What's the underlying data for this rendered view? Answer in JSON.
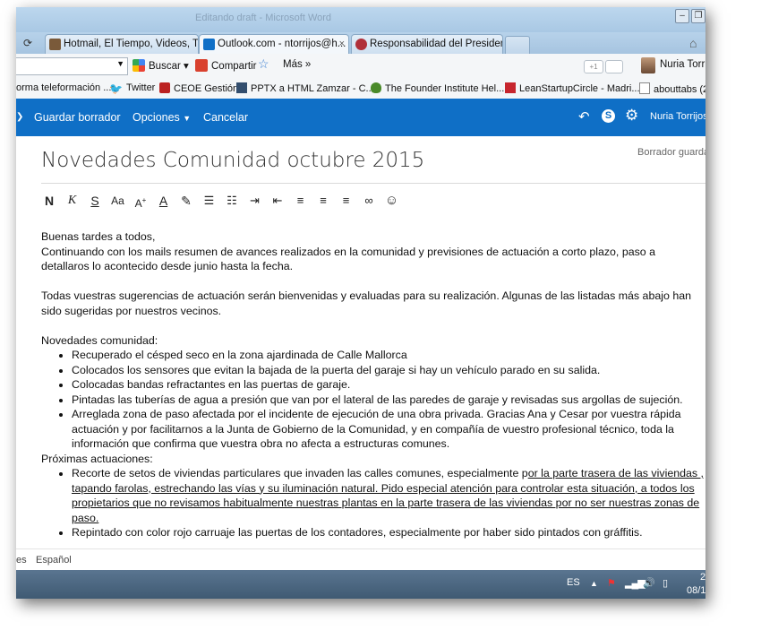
{
  "window": {
    "title": "Editando draft - Microsoft Word"
  },
  "tabs": [
    {
      "label": "Hotmail, El Tiempo, Videos, TV...",
      "icon_color": "#7a5a3a"
    },
    {
      "label": "Outlook.com - ntorrijos@h...",
      "icon_color": "#0f6fc6",
      "close": "×"
    },
    {
      "label": "Responsabilidad del Presidente...",
      "icon_color": "#b0303a"
    }
  ],
  "toolbar": {
    "buscar": "Buscar",
    "compartir": "Compartir",
    "mas": "Más »",
    "plusone": "+1",
    "user": "Nuria Torrij"
  },
  "bookmarks": [
    "orma teleformación ...",
    "Twitter",
    "CEOE Gestión",
    "PPTX a HTML  Zamzar - C...",
    "The Founder Institute Hel...",
    "LeanStartupCircle - Madri...",
    "abouttabs (2"
  ],
  "outlook": {
    "save_draft": "Guardar borrador",
    "options": "Opciones",
    "cancel": "Cancelar",
    "user_name": "Nuria Torrijos",
    "draft_status": "Borrador guarda",
    "accent": "#0f6fc6"
  },
  "message": {
    "subject": "Novedades Comunidad octubre 2015",
    "greeting": "Buenas tardes a todos,",
    "intro": "Continuando con los mails resumen de avances realizados en la comunidad y previsiones de actuación a corto plazo, paso a detallaros lo acontecido desde junio hasta la fecha.",
    "suggestions": "Todas vuestras sugerencias de actuación serán bienvenidas y evaluadas para su realización. Algunas de las listadas más abajo han sido sugeridas por nuestros vecinos.",
    "news_heading": "Novedades comunidad:",
    "news_items": [
      "Recuperado el césped seco en la zona ajardinada de Calle Mallorca",
      "Colocados los sensores que evitan la bajada de la puerta del garaje si hay un vehículo parado en su salida.",
      "Colocadas bandas refractantes en las puertas de garaje.",
      "Pintadas las tuberías de agua a presión que van por el lateral de las paredes de garaje y revisadas sus argollas de sujeción.",
      "Arreglada zona de paso afectada por el incidente de ejecución de una obra privada. Gracias Ana y Cesar por vuestra rápida actuación y por facilitarnos a la Junta de Gobierno de la Comunidad, y en compañía de vuestro profesional técnico, toda la información que confirma que vuestra obra no afecta a estructuras comunes."
    ],
    "next_heading": "Próximas actuaciones:",
    "next_item1_plain": "Recorte de setos de viviendas particulares que invaden las calles comunes, especialmente p",
    "next_item1_underlined": "or la parte trasera de las viviendas , tapando farolas, estrechando las vías y su iluminación natural. Pido especial atención para controlar esta situación, a todos los propietarios que no revisamos habitualmente nuestras plantas en la parte trasera de las viviendas por no ser nuestras zonas de paso. ",
    "next_item2": "Repintado con color rojo carruaje las puertas de los contadores, especialmente por haber sido pintados con gráffitis."
  },
  "footer": {
    "partial": "es",
    "language": "Español"
  },
  "taskbar": {
    "lang": "ES",
    "clock_top": "2",
    "clock_bottom": "08/1"
  }
}
